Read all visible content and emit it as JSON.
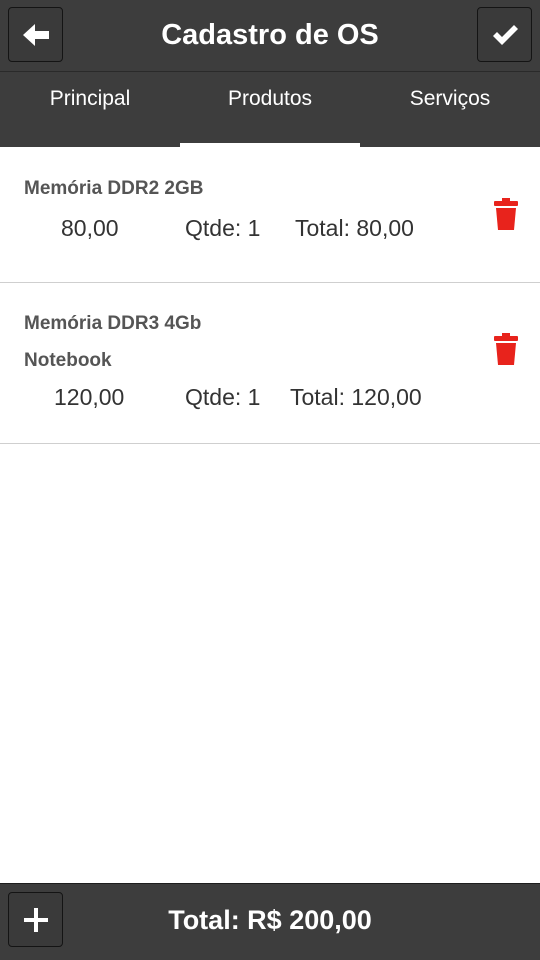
{
  "header": {
    "title": "Cadastro de OS",
    "back_icon": "arrow-left-icon",
    "confirm_icon": "checkmark-icon"
  },
  "tabs": [
    {
      "label": "Principal",
      "active": false
    },
    {
      "label": "Produtos",
      "active": true
    },
    {
      "label": "Serviços",
      "active": false
    }
  ],
  "items": [
    {
      "name": "Memória DDR2 2GB",
      "price": "80,00",
      "qty": "Qtde: 1",
      "total": "Total: 80,00",
      "delete_icon": "trash-icon"
    },
    {
      "name": "Memória DDR3 4Gb",
      "subtitle": "Notebook",
      "price": "120,00",
      "qty": "Qtde: 1",
      "total": "Total: 120,00",
      "delete_icon": "trash-icon"
    }
  ],
  "footer": {
    "add_icon": "plus-icon",
    "total": "Total: R$ 200,00"
  },
  "colors": {
    "bar_background": "#3d3d3d",
    "delete": "#e8231c",
    "text_primary": "#333333",
    "text_secondary": "#555555"
  }
}
